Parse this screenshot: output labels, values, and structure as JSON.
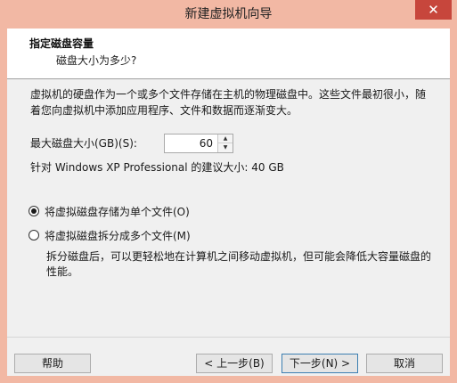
{
  "window": {
    "title": "新建虚拟机向导",
    "close_glyph": "✕"
  },
  "header": {
    "title": "指定磁盘容量",
    "subtitle": "磁盘大小为多少?"
  },
  "description": "虚拟机的硬盘作为一个或多个文件存储在主机的物理磁盘中。这些文件最初很小，随着您向虚拟机中添加应用程序、文件和数据而逐渐变大。",
  "disk_size": {
    "label": "最大磁盘大小(GB)(S):",
    "value": "60",
    "recommended": "针对 Windows XP Professional 的建议大小: 40 GB"
  },
  "storage_options": [
    {
      "label": "将虚拟磁盘存储为单个文件(O)",
      "selected": true
    },
    {
      "label": "将虚拟磁盘拆分成多个文件(M)",
      "selected": false
    }
  ],
  "split_description": "拆分磁盘后，可以更轻松地在计算机之间移动虚拟机，但可能会降低大容量磁盘的性能。",
  "buttons": {
    "help": "帮助",
    "back": "< 上一步(B)",
    "next": "下一步(N) >",
    "cancel": "取消"
  }
}
